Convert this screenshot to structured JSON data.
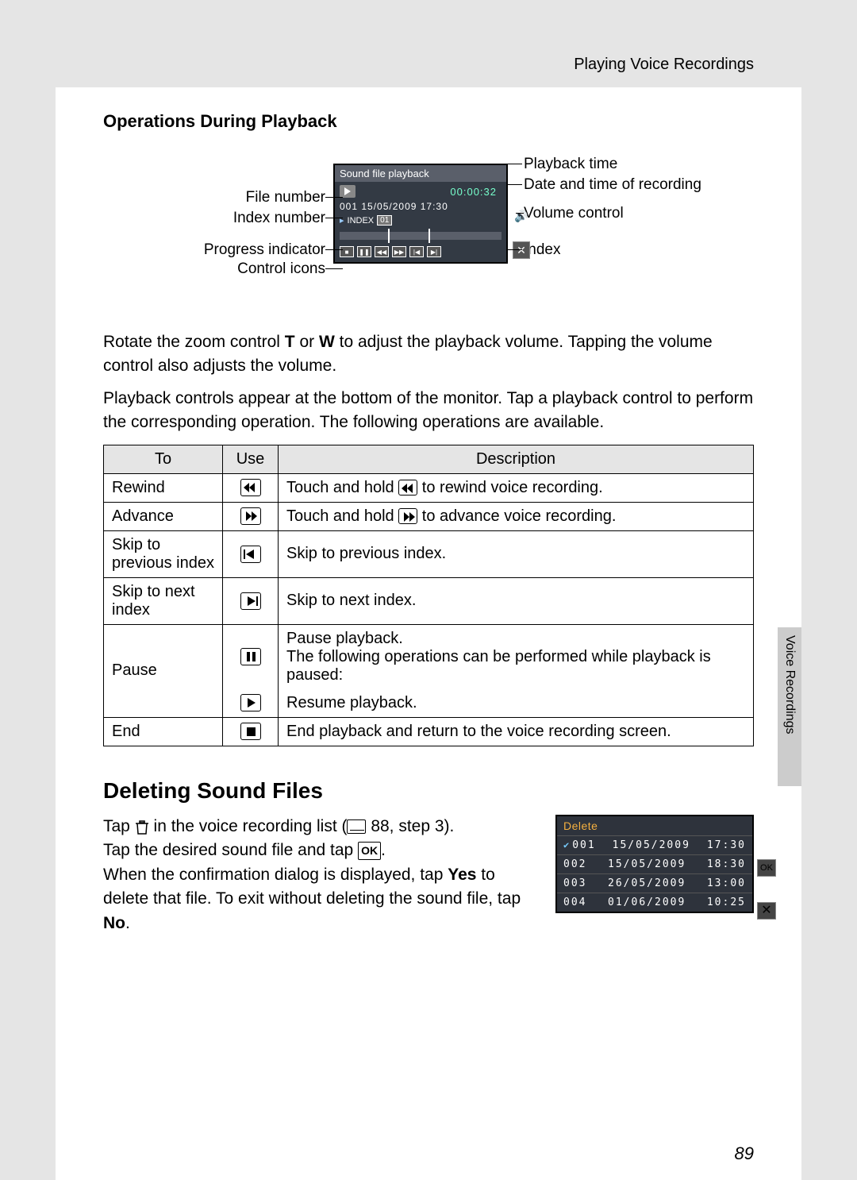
{
  "header": {
    "section_title": "Playing Voice Recordings"
  },
  "sub_heading": "Operations During Playback",
  "diagram": {
    "lcd": {
      "title": "Sound file playback",
      "time": "00:00:32",
      "meta": "001  15/05/2009  17:30",
      "index_prefix": "INDEX",
      "index_num": "01"
    },
    "left_labels": {
      "file_number": "File number",
      "index_number": "Index number",
      "progress_indicator": "Progress indicator",
      "control_icons": "Control icons"
    },
    "right_labels": {
      "playback_time": "Playback time",
      "date_time": "Date and time of recording",
      "volume_control": "Volume control",
      "index": "Index"
    }
  },
  "para1_a": "Rotate the zoom control ",
  "para1_b": " or ",
  "para1_c": " to adjust the playback volume. Tapping the volume control also adjusts the volume.",
  "zoom_t": "T",
  "zoom_w": "W",
  "para2": "Playback controls appear at the bottom of the monitor. Tap a playback control to perform the corresponding operation. The following operations are available.",
  "table": {
    "headers": {
      "to": "To",
      "use": "Use",
      "desc": "Description"
    },
    "rows": {
      "rewind": {
        "to": "Rewind",
        "desc_a": "Touch and hold ",
        "desc_b": " to rewind voice recording."
      },
      "advance": {
        "to": "Advance",
        "desc_a": "Touch and hold ",
        "desc_b": " to advance voice recording."
      },
      "skip_prev": {
        "to": "Skip to previous index",
        "desc": "Skip to previous index."
      },
      "skip_next": {
        "to": "Skip to next index",
        "desc": "Skip to next index."
      },
      "pause": {
        "to": "Pause",
        "desc1": "Pause playback.",
        "desc2": "The following operations can be performed while playback is paused:",
        "desc3": "Resume playback."
      },
      "end": {
        "to": "End",
        "desc": "End playback and return to the voice recording screen."
      }
    }
  },
  "h2": "Deleting Sound Files",
  "delete": {
    "line1_a": "Tap ",
    "line1_b": " in the voice recording list (",
    "line1_c": " 88, step 3).",
    "line2_a": "Tap the desired sound file and tap ",
    "line2_b": ".",
    "line3_a": "When the confirmation dialog is displayed, tap ",
    "yes": "Yes",
    "line3_b": " to delete that file. To exit without deleting the sound file, tap ",
    "no": "No",
    "line3_c": ".",
    "ok_label": "OK",
    "panel": {
      "title": "Delete",
      "rows": [
        {
          "num": "001",
          "date": "15/05/2009",
          "time": "17:30",
          "checked": true
        },
        {
          "num": "002",
          "date": "15/05/2009",
          "time": "18:30",
          "checked": false
        },
        {
          "num": "003",
          "date": "26/05/2009",
          "time": "13:00",
          "checked": false
        },
        {
          "num": "004",
          "date": "01/06/2009",
          "time": "10:25",
          "checked": false
        }
      ],
      "side_ok": "OK"
    }
  },
  "side_tab": "Voice Recordings",
  "page_number": "89"
}
